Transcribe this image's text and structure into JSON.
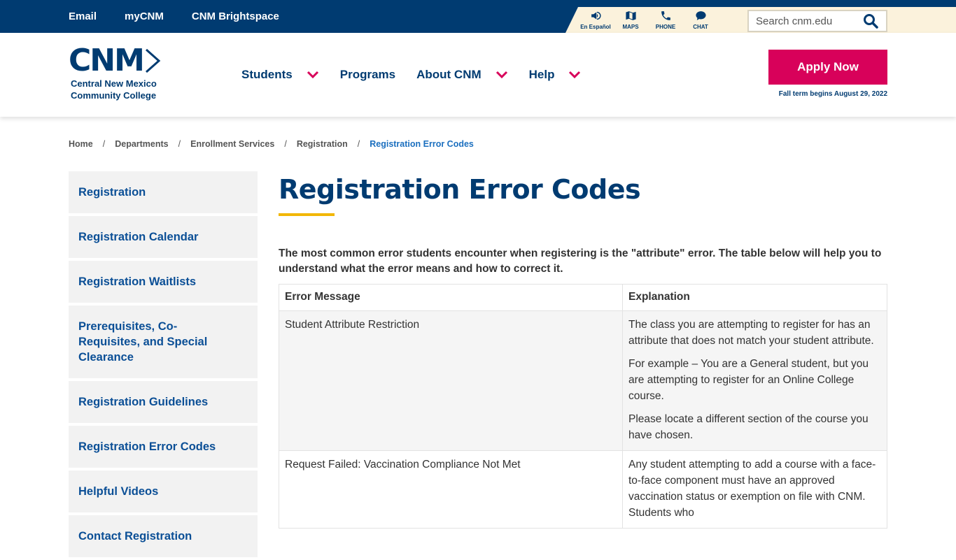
{
  "topbar": {
    "links": [
      "Email",
      "myCNM",
      "CNM Brightspace"
    ],
    "utilities": [
      {
        "icon": "megaphone-icon",
        "label": "En Español"
      },
      {
        "icon": "map-icon",
        "label": "MAPS"
      },
      {
        "icon": "phone-icon",
        "label": "PHONE"
      },
      {
        "icon": "chat-icon",
        "label": "CHAT"
      }
    ],
    "search_placeholder": "Search cnm.edu"
  },
  "logo": {
    "letters": "CNM",
    "line1": "Central New Mexico",
    "line2": "Community College"
  },
  "nav": {
    "items": [
      {
        "label": "Students",
        "dropdown": true
      },
      {
        "label": "Programs",
        "dropdown": false
      },
      {
        "label": "About CNM",
        "dropdown": true
      },
      {
        "label": "Help",
        "dropdown": true
      }
    ],
    "apply_label": "Apply Now",
    "term_note": "Fall term begins August 29, 2022"
  },
  "breadcrumb": {
    "items": [
      "Home",
      "Departments",
      "Enrollment Services",
      "Registration"
    ],
    "current": "Registration Error Codes"
  },
  "sidebar": {
    "items": [
      "Registration",
      "Registration Calendar",
      "Registration Waitlists",
      "Prerequisites, Co-Requisites, and Special Clearance",
      "Registration Guidelines",
      "Registration Error Codes",
      "Helpful Videos",
      "Contact Registration"
    ]
  },
  "main": {
    "title": "Registration Error Codes",
    "intro": "The most common error students encounter when registering is the \"attribute\" error. The table below will help you to understand what the error means and how to correct it.",
    "table": {
      "headers": [
        "Error Message",
        "Explanation"
      ],
      "rows": [
        {
          "message": "Student Attribute Restriction",
          "explanation": [
            "The class you are attempting to register for has an attribute that does not match your student attribute.",
            "For example – You are a General student, but you are attempting to register for an Online College course.",
            "Please locate a different section of the course you have chosen."
          ]
        },
        {
          "message": "Request Failed: Vaccination Compliance Not Met",
          "explanation": [
            "Any student attempting to add a course with a face-to-face component must have an approved vaccination status or exemption on file with CNM. Students who"
          ]
        }
      ]
    }
  },
  "colors": {
    "navy": "#003b71",
    "accent_pink": "#d8015a",
    "gold": "#f2b705",
    "link_blue": "#1b6fbf"
  }
}
